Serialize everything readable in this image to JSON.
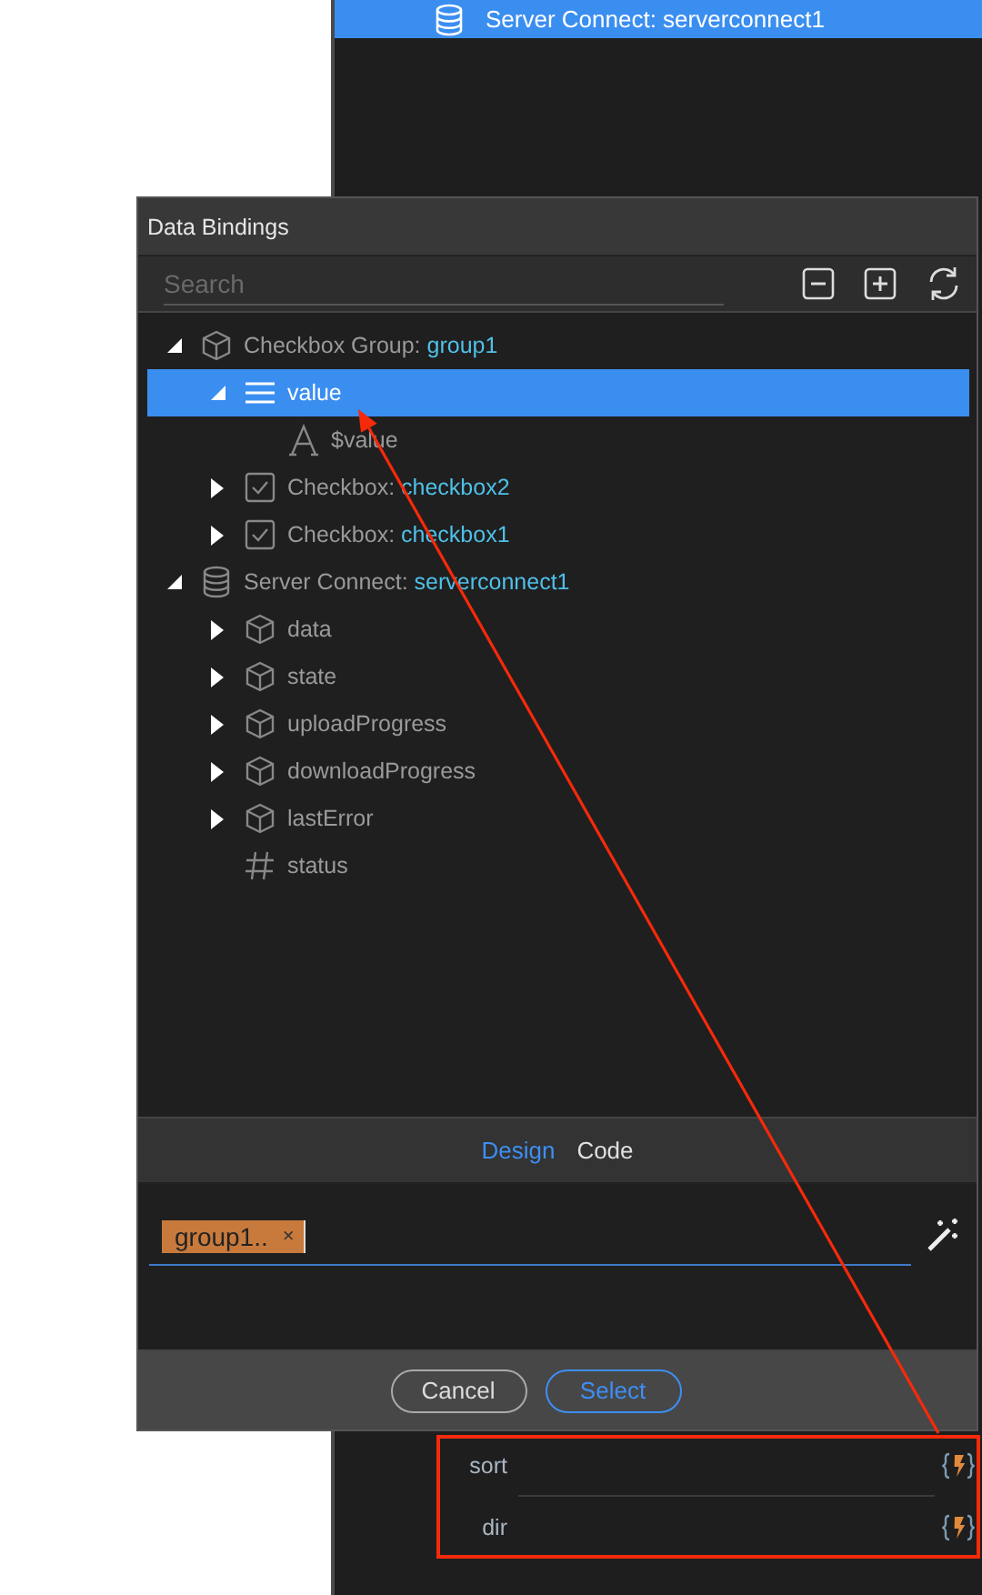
{
  "background_panel": {
    "top_item": {
      "label": "Server Connect: serverconnect1",
      "selected": true
    },
    "parameters": [
      {
        "label": "sort"
      },
      {
        "label": "dir"
      }
    ]
  },
  "dialog": {
    "title": "Data Bindings",
    "search": {
      "placeholder": "Search"
    },
    "tree": [
      {
        "kind": "object",
        "label": "Checkbox Group: ",
        "name": "group1",
        "expanded": true,
        "selected": false,
        "children": [
          {
            "kind": "array",
            "label": "value",
            "expanded": true,
            "selected": true,
            "children": [
              {
                "kind": "text",
                "label": "$value",
                "selected": false
              }
            ]
          },
          {
            "kind": "checkbox",
            "label": "Checkbox: ",
            "name": "checkbox2",
            "expanded": false,
            "selected": false
          },
          {
            "kind": "checkbox",
            "label": "Checkbox: ",
            "name": "checkbox1",
            "expanded": false,
            "selected": false
          }
        ]
      },
      {
        "kind": "database",
        "label": "Server Connect: ",
        "name": "serverconnect1",
        "expanded": true,
        "selected": false,
        "children": [
          {
            "kind": "object",
            "label": "data",
            "expanded": false,
            "selected": false
          },
          {
            "kind": "object",
            "label": "state",
            "expanded": false,
            "selected": false
          },
          {
            "kind": "object",
            "label": "uploadProgress",
            "expanded": false,
            "selected": false
          },
          {
            "kind": "object",
            "label": "downloadProgress",
            "expanded": false,
            "selected": false
          },
          {
            "kind": "object",
            "label": "lastError",
            "expanded": false,
            "selected": false
          },
          {
            "kind": "number",
            "label": "status",
            "selected": false
          }
        ]
      }
    ],
    "tabs": [
      {
        "label": "Design",
        "selected": true
      },
      {
        "label": "Code",
        "selected": false
      }
    ],
    "expression_tags": [
      {
        "label": "group1..",
        "remove": "×"
      }
    ],
    "buttons": [
      {
        "label": "Cancel",
        "kind": "secondary"
      },
      {
        "label": "Select",
        "kind": "primary"
      }
    ]
  }
}
